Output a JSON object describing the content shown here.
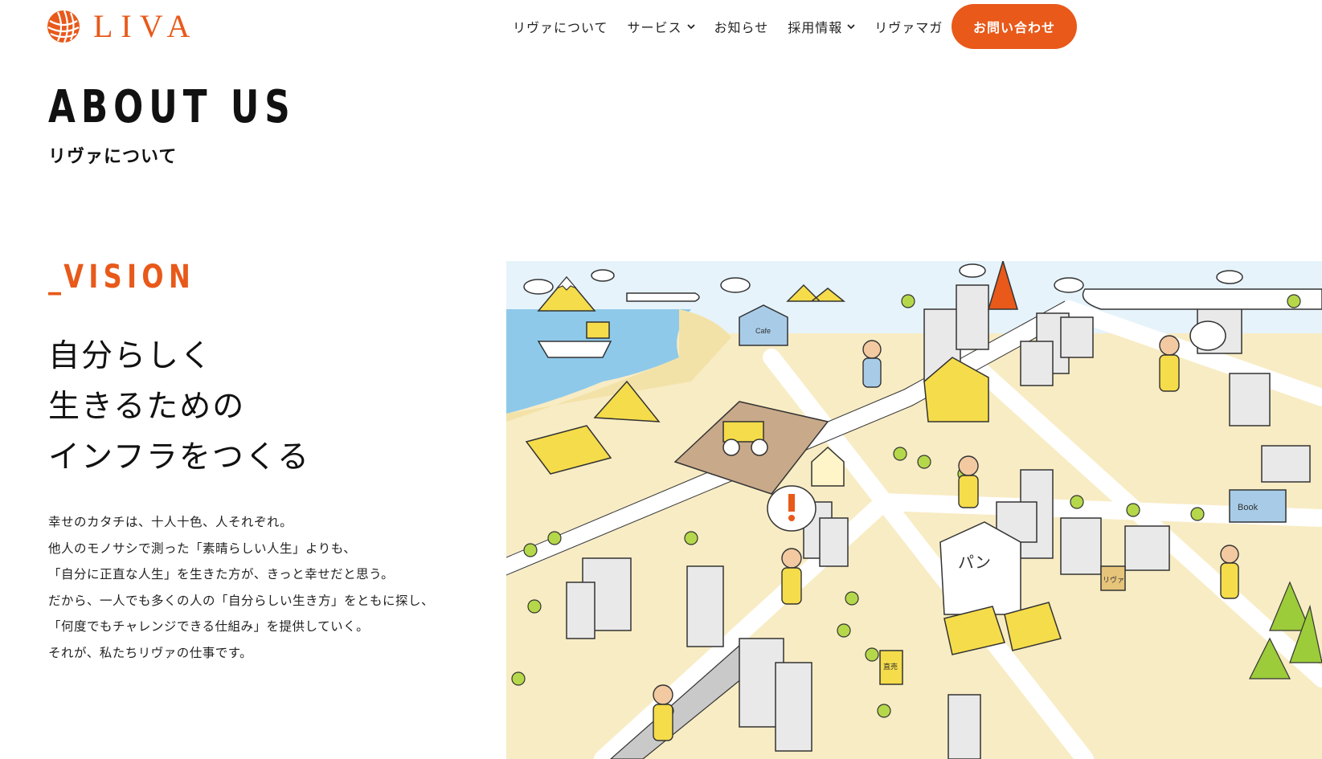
{
  "header": {
    "logo_text": "LIVA",
    "nav": [
      {
        "label": "リヴァについて",
        "has_dropdown": false
      },
      {
        "label": "サービス",
        "has_dropdown": true
      },
      {
        "label": "お知らせ",
        "has_dropdown": false
      },
      {
        "label": "採用情報",
        "has_dropdown": true
      },
      {
        "label": "リヴァマガ",
        "has_dropdown": false
      }
    ],
    "contact_label": "お問い合わせ"
  },
  "about": {
    "title": "ABOUT US",
    "subtitle": "リヴァについて"
  },
  "vision": {
    "label": "VISION",
    "underscore": "_",
    "headline": [
      "自分らしく",
      "生きるための",
      "インフラをつくる"
    ],
    "body": [
      "幸せのカタチは、十人十色、人それぞれ。",
      "他人のモノサシで測った「素晴らしい人生」よりも、",
      "「自分に正直な人生」を生きた方が、きっと幸せだと思う。",
      "だから、一人でも多くの人の「自分らしい生き方」をともに探し、",
      "「何度でもチャレンジできる仕組み」を提供していく。",
      "それが、私たちリヴァの仕事です。"
    ]
  },
  "illustration": {
    "signs": {
      "cafe": "Cafe",
      "pan": "パン",
      "book": "Book",
      "liva_sign": "リヴァ",
      "market": "直売"
    }
  },
  "colors": {
    "accent": "#e8591a",
    "illus_ground": "#f8ecc4",
    "illus_sea": "#8ec9ea",
    "illus_yellow": "#f5dc4a",
    "illus_road": "#ffffff"
  }
}
